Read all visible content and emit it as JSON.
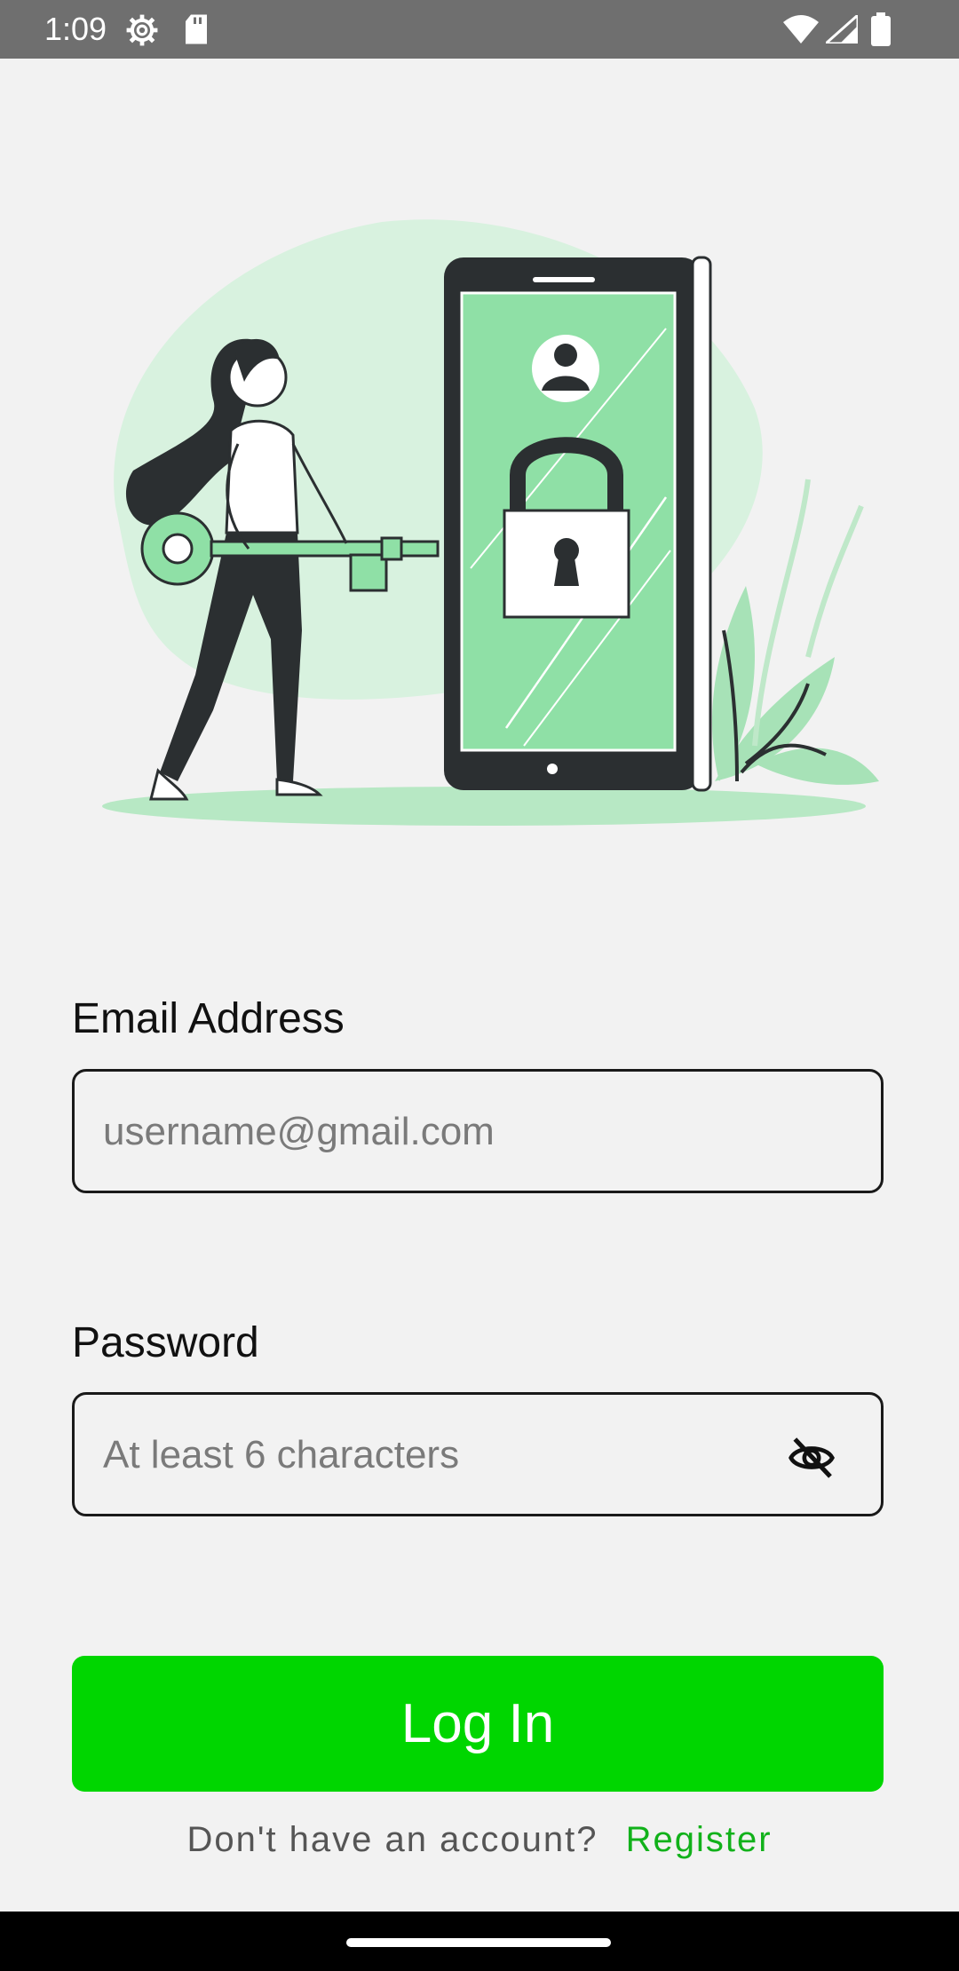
{
  "status_bar": {
    "time": "1:09",
    "icons": [
      "settings-icon",
      "sd-card-icon",
      "wifi-icon",
      "signal-icon",
      "battery-icon"
    ]
  },
  "illustration": {
    "description_icon": "security-login-illustration",
    "accent_color": "#8fe0a6"
  },
  "form": {
    "email": {
      "label": "Email Address",
      "placeholder": "username@gmail.com",
      "value": ""
    },
    "password": {
      "label": "Password",
      "placeholder": "At least 6 characters",
      "value": "",
      "toggle_icon": "eye-off-icon"
    },
    "login_label": "Log In",
    "register_prompt": "Don't have an account?",
    "register_link": "Register"
  },
  "colors": {
    "primary": "#00d600",
    "link": "#11b11a",
    "background": "#f2f2f2"
  }
}
